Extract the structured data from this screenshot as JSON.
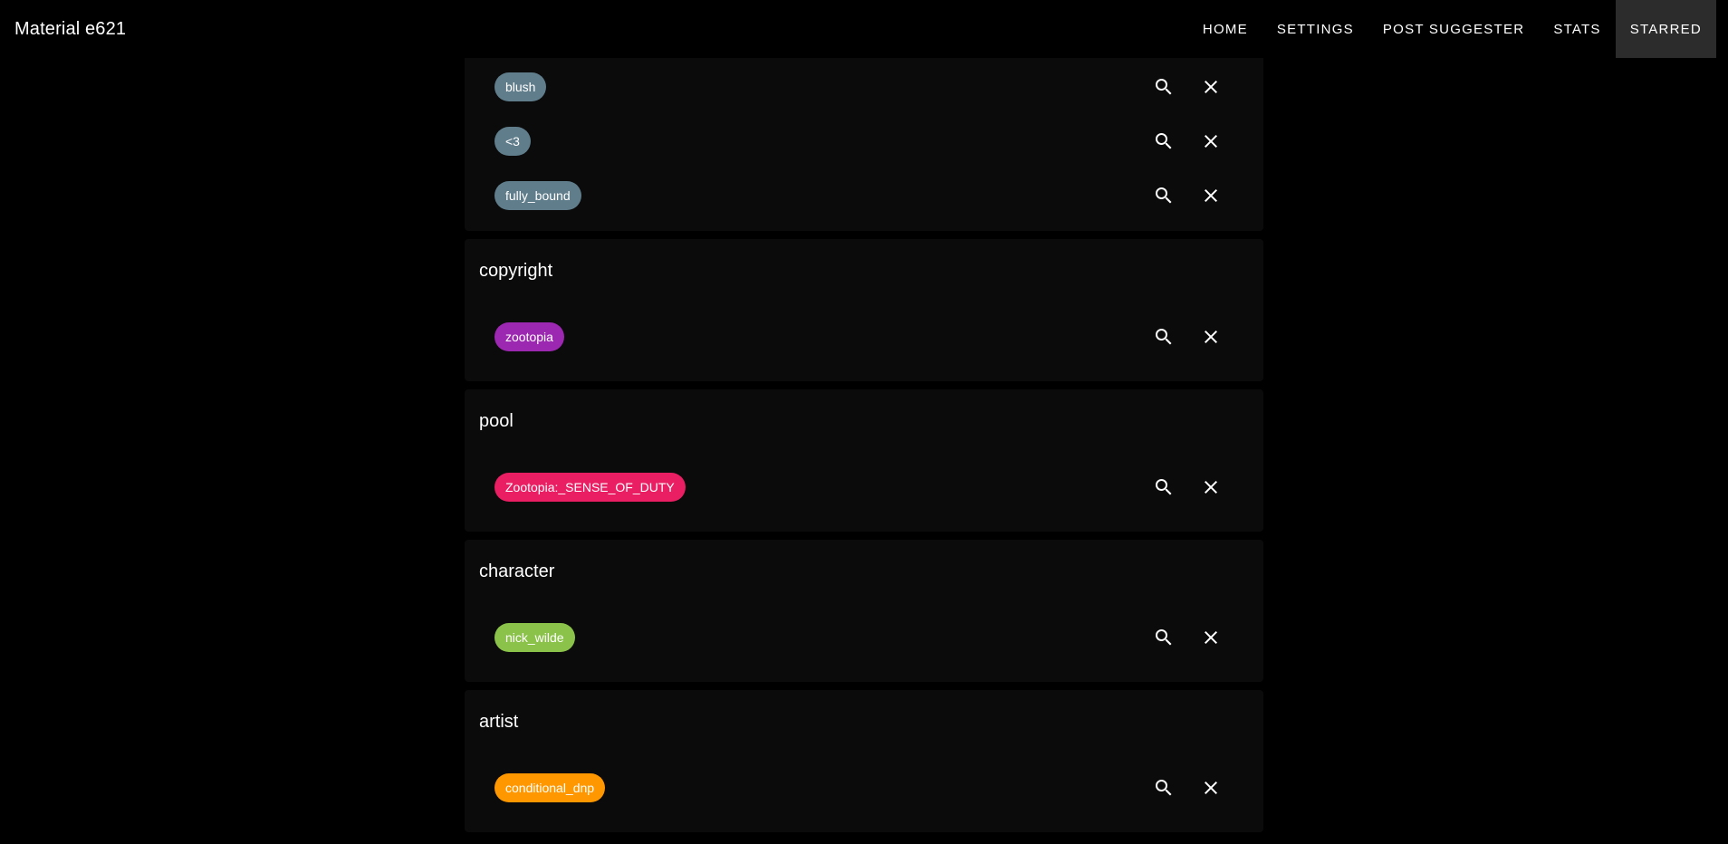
{
  "app": {
    "title": "Material e621"
  },
  "nav": {
    "items": [
      {
        "label": "HOME"
      },
      {
        "label": "SETTINGS"
      },
      {
        "label": "POST SUGGESTER"
      },
      {
        "label": "STATS"
      },
      {
        "label": "STARRED",
        "active": true
      }
    ]
  },
  "general_tags": [
    {
      "label": "blush",
      "color": "#607d8b"
    },
    {
      "label": "<3",
      "color": "#607d8b"
    },
    {
      "label": "fully_bound",
      "color": "#607d8b"
    }
  ],
  "sections": [
    {
      "title": "copyright",
      "tag": "zootopia",
      "color": "#9c27b0"
    },
    {
      "title": "pool",
      "tag": "Zootopia:_SENSE_OF_DUTY",
      "color": "#e91e63"
    },
    {
      "title": "character",
      "tag": "nick_wilde",
      "color": "#8bc34a"
    },
    {
      "title": "artist",
      "tag": "conditional_dnp",
      "color": "#ff9800"
    }
  ],
  "icons": {
    "search": "search-icon",
    "remove": "close-icon"
  }
}
